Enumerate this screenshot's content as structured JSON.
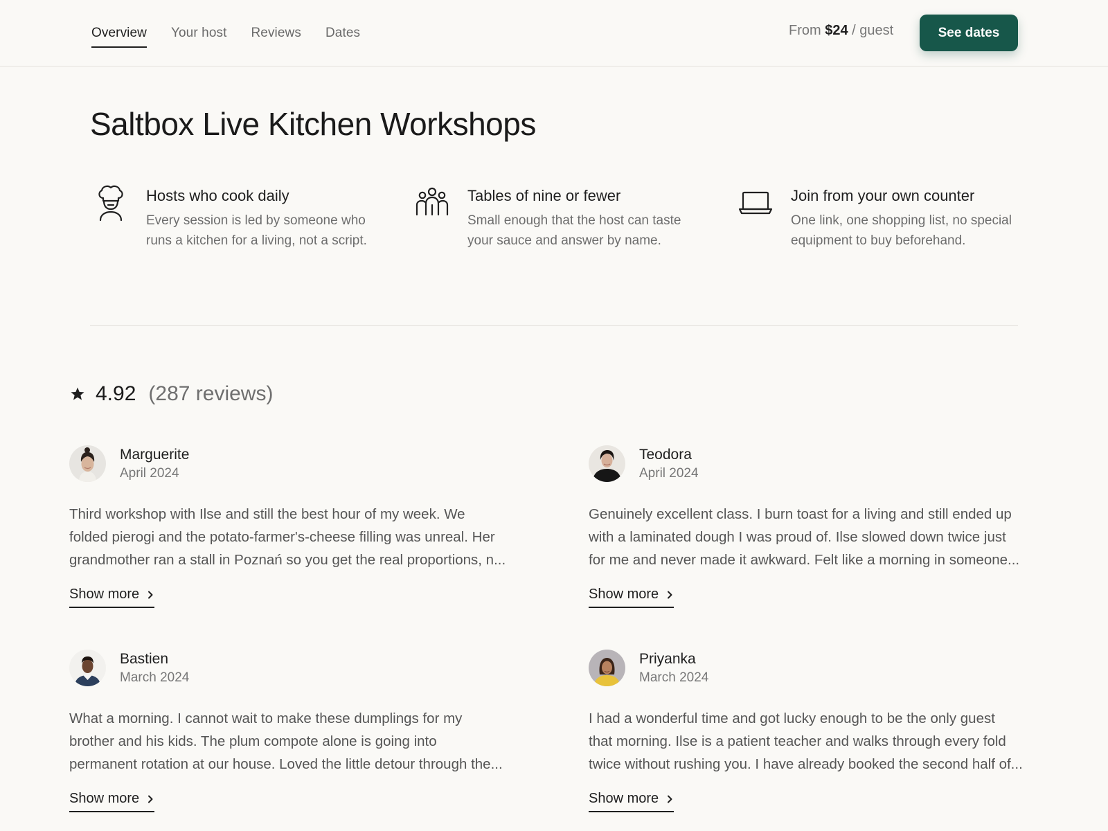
{
  "nav": {
    "tabs": [
      {
        "label": "Overview",
        "active": true
      },
      {
        "label": "Your host"
      },
      {
        "label": "Reviews"
      },
      {
        "label": "Dates"
      }
    ],
    "price_prefix": "From",
    "price_amount": "$24",
    "price_suffix": "/ guest",
    "cta_label": "See dates"
  },
  "title": "Saltbox Live Kitchen Workshops",
  "features": [
    {
      "icon": "chef-hat-icon",
      "title": "Hosts who cook daily",
      "desc": "Every session is led by someone who runs a kitchen for a living, not a script."
    },
    {
      "icon": "group-icon",
      "title": "Tables of nine or fewer",
      "desc": "Small enough that the host can taste your sauce and answer by name."
    },
    {
      "icon": "laptop-icon",
      "title": "Join from your own counter",
      "desc": "One link, one shopping list, no special equipment to buy beforehand."
    }
  ],
  "rating": {
    "score": "4.92",
    "count": "(287 reviews)"
  },
  "reviews": [
    {
      "name": "Marguerite",
      "date": "April 2024",
      "lines": [
        "Third workshop with Ilse and still the best hour of my week. We",
        "folded pierogi and the potato-farmer's-cheese filling was unreal. Her",
        "grandmother ran a stall in Poznań so you get the real proportions, n..."
      ],
      "more": "Show more"
    },
    {
      "name": "Teodora",
      "date": "April 2024",
      "lines": [
        "Genuinely excellent class. I burn toast for a living and still ended up",
        "with a laminated dough I was proud of. Ilse slowed down twice just",
        "for me and never made it awkward. Felt like a morning in someone..."
      ],
      "more": "Show more"
    },
    {
      "name": "Bastien",
      "date": "March 2024",
      "lines": [
        "What a morning. I cannot wait to make these dumplings for my",
        "brother and his kids. The plum compote alone is going into",
        "permanent rotation at our house. Loved the little detour through the..."
      ],
      "more": "Show more"
    },
    {
      "name": "Priyanka",
      "date": "March 2024",
      "lines": [
        "I had a wonderful time and got lucky enough to be the only guest",
        "that morning. Ilse is a patient teacher and walks through every fold",
        "twice without rushing you. I have already booked the second half of..."
      ],
      "more": "Show more"
    }
  ],
  "colors": {
    "background": "#faf9f6",
    "accent": "#17574a",
    "text": "#1f1f1f",
    "muted": "#6d6d6d"
  }
}
